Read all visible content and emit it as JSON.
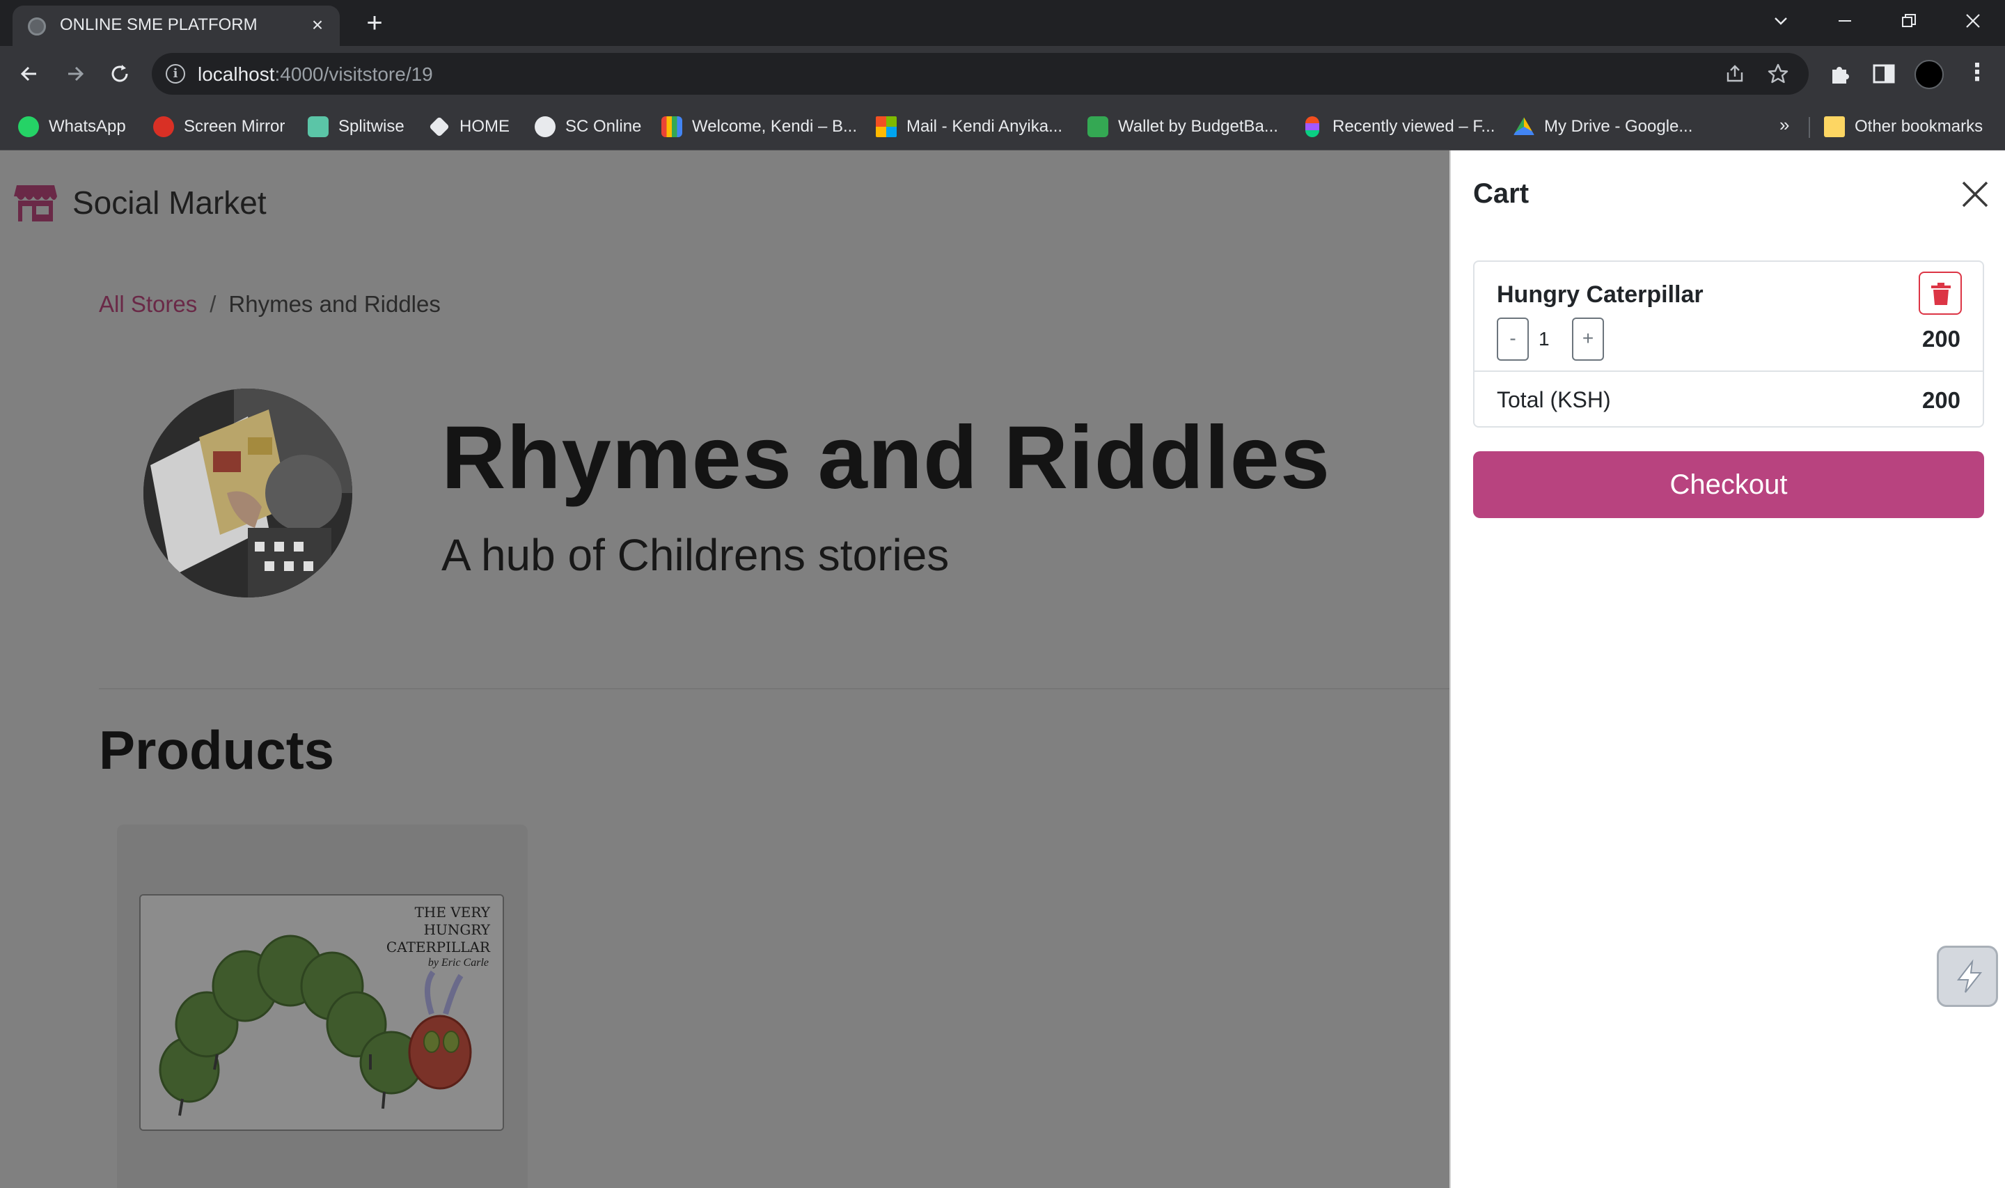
{
  "browser": {
    "tab_title": "ONLINE SME PLATFORM",
    "url_host": "localhost",
    "url_path": ":4000/visitstore/19",
    "bookmarks": [
      {
        "label": "WhatsApp",
        "color": "#25d366"
      },
      {
        "label": "Screen Mirror",
        "color": "#d93025"
      },
      {
        "label": "Splitwise",
        "color": "#5bc5a7"
      },
      {
        "label": "HOME",
        "color": "#e8eaed"
      },
      {
        "label": "SC Online",
        "color": "#e8eaed"
      },
      {
        "label": "Welcome, Kendi – B...",
        "color": "#fbbc04"
      },
      {
        "label": "Mail - Kendi Anyika...",
        "color": "#f25022"
      },
      {
        "label": "Wallet by BudgetBa...",
        "color": "#34a853"
      },
      {
        "label": "Recently viewed – F...",
        "color": "#a259ff"
      },
      {
        "label": "My Drive - Google...",
        "color": "#4285f4"
      }
    ],
    "overflow_label": "»",
    "other_bookmarks": "Other bookmarks"
  },
  "site": {
    "brand": "Social Market",
    "breadcrumb": {
      "root": "All Stores",
      "separator": "/",
      "current": "Rhymes and Riddles"
    },
    "store_title": "Rhymes and Riddles",
    "store_subtitle": "A hub of Childrens stories",
    "products_heading": "Products",
    "product_cover": {
      "title_lines": [
        "THE VERY",
        "HUNGRY",
        "CATERPILLAR"
      ],
      "author": "by Eric Carle"
    }
  },
  "cart": {
    "title": "Cart",
    "item_name": "Hungry Caterpillar",
    "qty_minus": "-",
    "qty_value": "1",
    "qty_plus": "+",
    "item_price": "200",
    "total_label": "Total (KSH)",
    "total_value": "200",
    "checkout_label": "Checkout"
  },
  "colors": {
    "accent": "#b8437f",
    "brand_link": "#6a2947",
    "danger": "#dc3545",
    "overlay": "#808080"
  }
}
